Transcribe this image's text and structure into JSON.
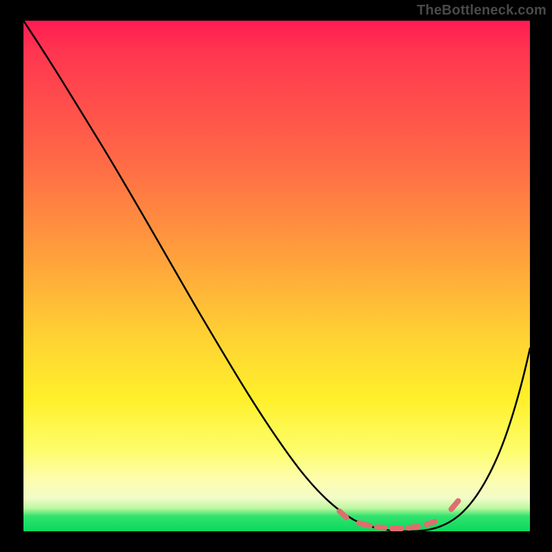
{
  "watermark": "TheBottleneck.com",
  "chart_data": {
    "type": "line",
    "title": "",
    "xlabel": "",
    "ylabel": "",
    "xlim": [
      0,
      100
    ],
    "ylim": [
      0,
      100
    ],
    "grid": false,
    "legend": false,
    "series": [
      {
        "name": "main-curve",
        "color": "#000000",
        "x": [
          0,
          10,
          20,
          30,
          40,
          50,
          58,
          62,
          66,
          70,
          74,
          78,
          82,
          86,
          90,
          94,
          100
        ],
        "values": [
          100,
          88,
          74,
          60,
          46,
          32,
          18,
          11,
          6,
          3,
          1,
          1,
          2,
          5,
          12,
          24,
          48
        ]
      },
      {
        "name": "markers",
        "color": "#e46a6a",
        "style": "dashed-markers",
        "x": [
          62,
          67,
          71,
          74,
          77,
          80,
          85
        ],
        "values": [
          4,
          2,
          1,
          1,
          1,
          1,
          3
        ]
      }
    ],
    "annotations": []
  }
}
